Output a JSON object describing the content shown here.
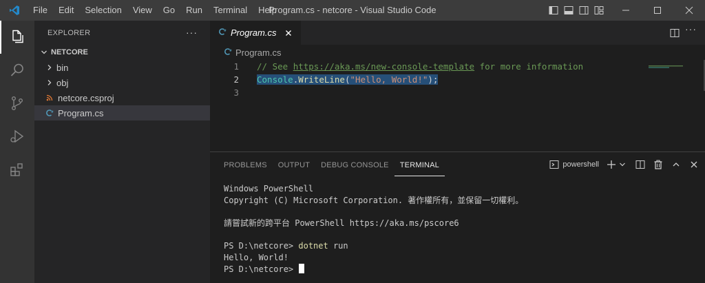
{
  "window": {
    "title": "Program.cs - netcore - Visual Studio Code"
  },
  "menu": [
    "File",
    "Edit",
    "Selection",
    "View",
    "Go",
    "Run",
    "Terminal",
    "Help"
  ],
  "colors": {
    "titlebar": "#3c3c3c",
    "activitybar": "#333333",
    "sidebar": "#252526",
    "editor": "#1e1e1e",
    "accent": "#007acc",
    "csharp_icon": "#519aba",
    "rss_icon": "#e37933"
  },
  "activity_icons": [
    "explorer-icon",
    "search-icon",
    "source-control-icon",
    "run-debug-icon",
    "extensions-icon"
  ],
  "explorer": {
    "header": "EXPLORER",
    "more": "···",
    "root": "NETCORE",
    "items": [
      {
        "label": "bin",
        "type": "folder"
      },
      {
        "label": "obj",
        "type": "folder"
      },
      {
        "label": "netcore.csproj",
        "type": "csproj"
      },
      {
        "label": "Program.cs",
        "type": "csharp"
      }
    ]
  },
  "editor": {
    "tab_label": "Program.cs",
    "tab_icon": "C#",
    "breadcrumb": "Program.cs",
    "more": "···",
    "lines": [
      {
        "number": "1",
        "comment_prefix": "// See ",
        "link": "https://aka.ms/new-console-template",
        "comment_suffix": " for more information"
      },
      {
        "number": "2",
        "class": "Console",
        "dot": ".",
        "method": "WriteLine",
        "open": "(",
        "string": "\"Hello, World!\"",
        "close": ");"
      },
      {
        "number": "3"
      }
    ]
  },
  "panel": {
    "tabs": [
      "PROBLEMS",
      "OUTPUT",
      "DEBUG CONSOLE",
      "TERMINAL"
    ],
    "active_tab": "TERMINAL",
    "shell": "powershell",
    "terminal": {
      "line1": "Windows PowerShell",
      "line2": "Copyright (C) Microsoft Corporation. 著作權所有，並保留一切權利。",
      "line3": "請嘗試新的跨平台 PowerShell https://aka.ms/pscore6",
      "prompt1": "PS D:\\netcore> ",
      "cmd_name": "dotnet",
      "cmd_args": " run",
      "output": "Hello, World!",
      "prompt2": "PS D:\\netcore> "
    }
  }
}
